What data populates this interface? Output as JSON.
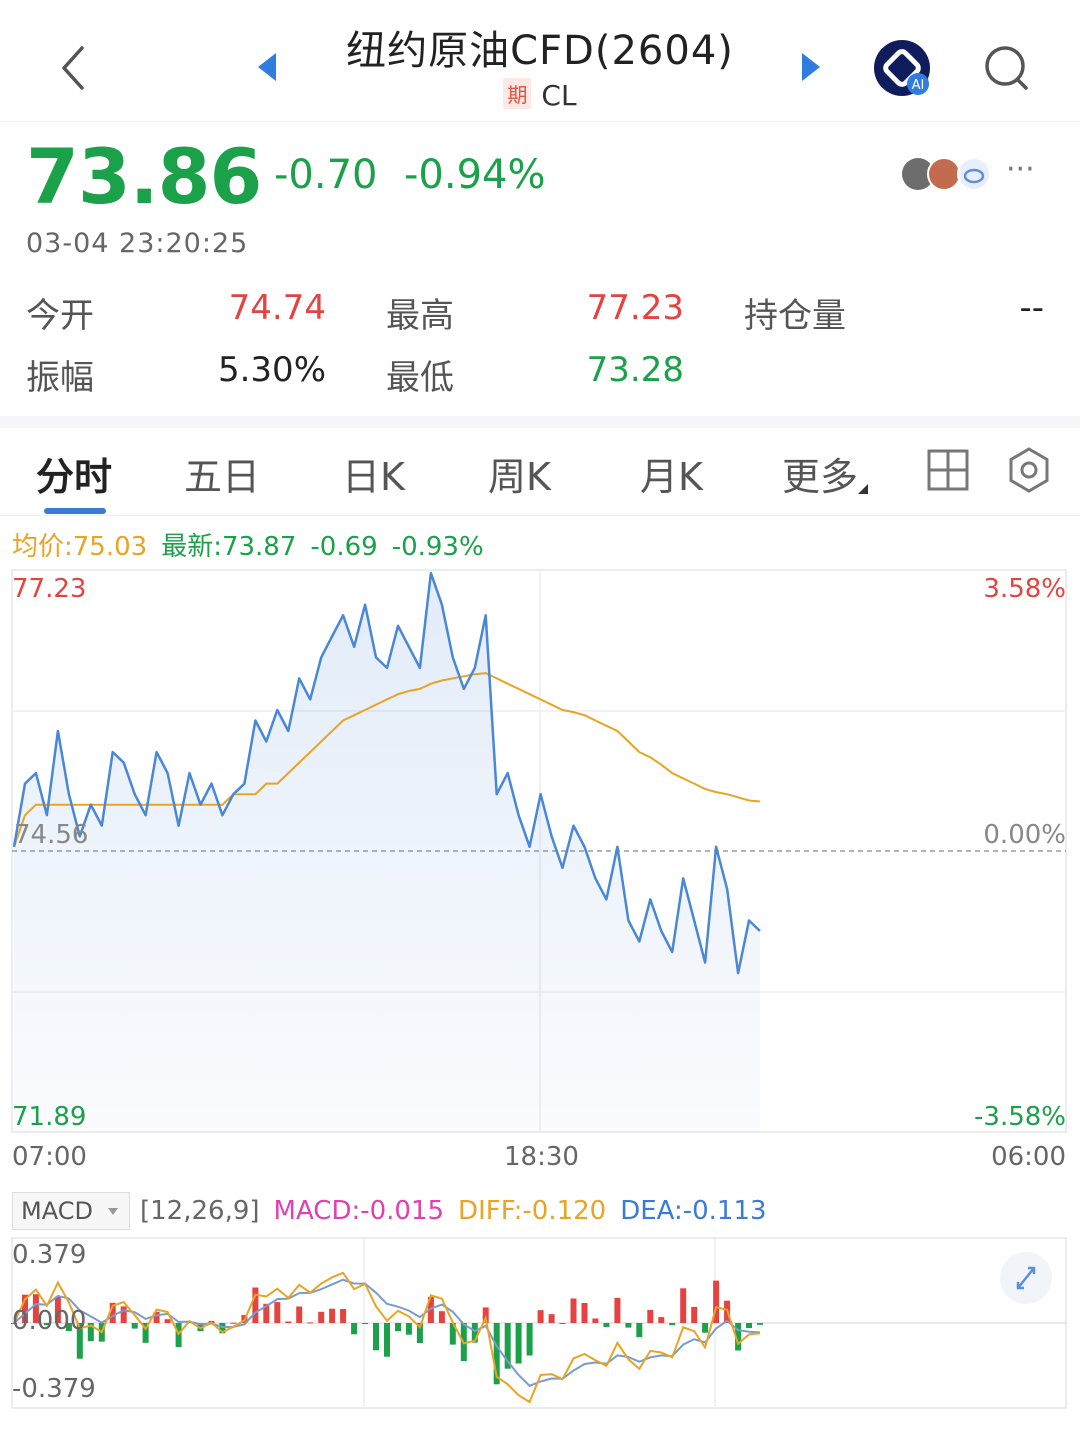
{
  "header": {
    "title": "纽约原油CFD(2604)",
    "badge": "期",
    "symbol": "CL",
    "ai_label": "AI"
  },
  "quote": {
    "price": "73.86",
    "change": "-0.70",
    "change_pct": "-0.94%",
    "timestamp": "03-04 23:20:25",
    "more": "···"
  },
  "stats": {
    "open_label": "今开",
    "open_value": "74.74",
    "high_label": "最高",
    "high_value": "77.23",
    "oi_label": "持仓量",
    "oi_value": "--",
    "amp_label": "振幅",
    "amp_value": "5.30%",
    "low_label": "最低",
    "low_value": "73.28"
  },
  "tabs": [
    "分时",
    "五日",
    "日K",
    "周K",
    "月K",
    "更多"
  ],
  "chart_header": {
    "avg": "均价:75.03",
    "latest": "最新:73.87",
    "change": "-0.69",
    "change_pct": "-0.93%"
  },
  "chart_axes": {
    "y_top": "77.23",
    "y_mid": "74.56",
    "y_bottom": "71.89",
    "pct_top": "3.58%",
    "pct_mid": "0.00%",
    "pct_bottom": "-3.58%",
    "time_start": "07:00",
    "time_mid": "18:30",
    "time_end": "06:00"
  },
  "macd": {
    "indicator": "MACD",
    "params": "[12,26,9]",
    "macd_value": "MACD:-0.015",
    "diff_value": "DIFF:-0.120",
    "dea_value": "DEA:-0.113",
    "y_top": "0.379",
    "y_mid": "0.000",
    "y_bottom": "-0.379"
  },
  "colors": {
    "up": "#e64340",
    "down": "#1aa14a",
    "price_line": "#4a87d6",
    "avg_line": "#e8a424",
    "macd_label": "#e040b0",
    "dea_label": "#3a7bd5"
  },
  "chart_data": {
    "type": "line",
    "ylim": [
      71.89,
      77.23
    ],
    "reference": 74.56,
    "xlim": [
      "07:00",
      "06:00"
    ],
    "x_ticks": [
      "07:00",
      "18:30",
      "06:00"
    ],
    "series": [
      {
        "key": "price",
        "values": [
          74.6,
          75.2,
          75.3,
          74.9,
          75.7,
          75.1,
          74.7,
          75.0,
          74.8,
          75.5,
          75.4,
          75.1,
          74.9,
          75.5,
          75.3,
          74.8,
          75.3,
          75.0,
          75.2,
          74.9,
          75.1,
          75.2,
          75.8,
          75.6,
          75.9,
          75.7,
          76.2,
          76.0,
          76.4,
          76.6,
          76.8,
          76.5,
          76.9,
          76.4,
          76.3,
          76.7,
          76.5,
          76.3,
          77.2,
          76.9,
          76.4,
          76.1,
          76.3,
          76.8,
          75.1,
          75.3,
          74.9,
          74.6,
          75.1,
          74.7,
          74.4,
          74.8,
          74.6,
          74.3,
          74.1,
          74.6,
          73.9,
          73.7,
          74.1,
          73.8,
          73.6,
          74.3,
          73.9,
          73.5,
          74.6,
          74.2,
          73.4,
          73.9,
          73.8
        ]
      },
      {
        "key": "average",
        "values": [
          74.6,
          74.9,
          75.0,
          75.0,
          75.0,
          75.0,
          75.0,
          75.0,
          75.0,
          75.0,
          75.0,
          75.0,
          75.0,
          75.0,
          75.0,
          75.0,
          75.0,
          75.0,
          75.0,
          75.0,
          75.1,
          75.1,
          75.1,
          75.2,
          75.2,
          75.3,
          75.4,
          75.5,
          75.6,
          75.7,
          75.8,
          75.85,
          75.9,
          75.95,
          76.0,
          76.05,
          76.08,
          76.1,
          76.15,
          76.18,
          76.2,
          76.22,
          76.24,
          76.25,
          76.2,
          76.15,
          76.1,
          76.05,
          76.0,
          75.95,
          75.9,
          75.88,
          75.85,
          75.8,
          75.75,
          75.7,
          75.6,
          75.5,
          75.45,
          75.38,
          75.3,
          75.25,
          75.2,
          75.15,
          75.12,
          75.1,
          75.07,
          75.04,
          75.03
        ]
      }
    ]
  }
}
